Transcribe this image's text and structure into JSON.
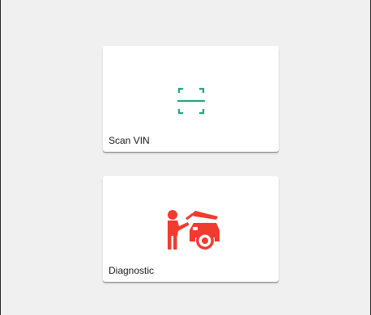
{
  "cards": [
    {
      "label": "Scan VIN",
      "icon": "scan-frame-icon",
      "icon_color": "#1aa67f"
    },
    {
      "label": "Diagnostic",
      "icon": "mechanic-car-icon",
      "icon_color": "#f03c2e"
    }
  ]
}
